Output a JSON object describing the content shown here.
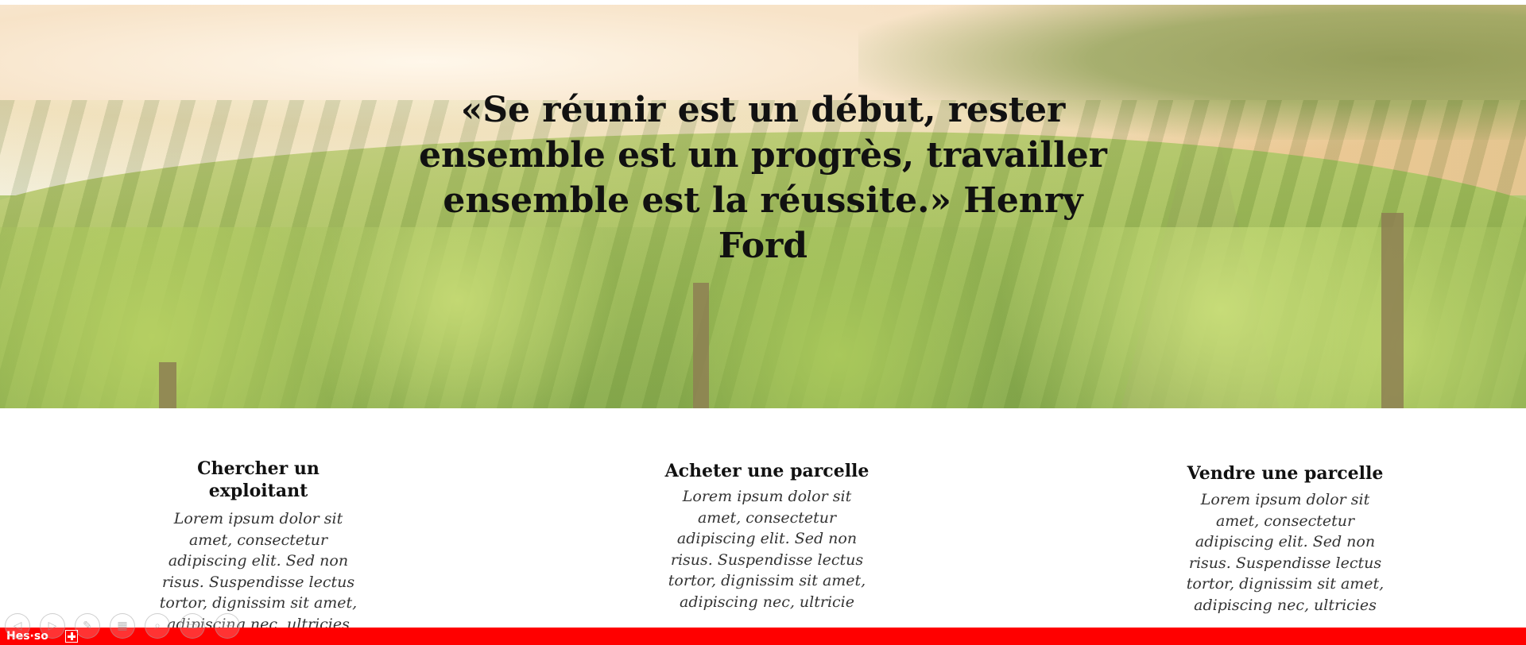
{
  "hero": {
    "quote_line1": "«Se réunir est un début, rester",
    "quote_line2": "ensemble est un progrès, travailler",
    "quote_line3": "ensemble est la réussite.» Henry Ford"
  },
  "columns": [
    {
      "title": "Chercher un exploitant",
      "lines": [
        "Lorem ipsum dolor sit",
        "amet, consectetur",
        "adipiscing elit. Sed non",
        "risus. Suspendisse lectus",
        "tortor, dignissim sit amet,",
        "adipiscing nec, ultricies"
      ]
    },
    {
      "title": "Acheter une parcelle",
      "lines": [
        "Lorem ipsum dolor sit",
        "amet, consectetur",
        "adipiscing elit. Sed non",
        "risus. Suspendisse lectus",
        "tortor, dignissim sit amet,",
        "adipiscing nec, ultricie"
      ]
    },
    {
      "title": "Vendre une parcelle",
      "lines": [
        "Lorem ipsum dolor sit",
        "amet, consectetur",
        "adipiscing elit. Sed non",
        "risus. Suspendisse lectus",
        "tortor, dignissim sit amet,",
        "adipiscing nec, ultricies"
      ]
    }
  ],
  "footer": {
    "logo": "Hes·so",
    "brand_color": "#ff0000"
  },
  "controls": [
    {
      "name": "previous-slide",
      "icon": "arrow-left-icon",
      "glyph": "◁"
    },
    {
      "name": "next-slide",
      "icon": "arrow-right-icon",
      "glyph": "▷"
    },
    {
      "name": "pen",
      "icon": "pen-icon",
      "glyph": "✎"
    },
    {
      "name": "all-slides",
      "icon": "grid-icon",
      "glyph": "▦"
    },
    {
      "name": "zoom",
      "icon": "magnifier-icon",
      "glyph": "⌕"
    },
    {
      "name": "subtitles",
      "icon": "screen-icon",
      "glyph": "▭"
    },
    {
      "name": "more-options",
      "icon": "more-icon",
      "glyph": "⋯"
    }
  ]
}
